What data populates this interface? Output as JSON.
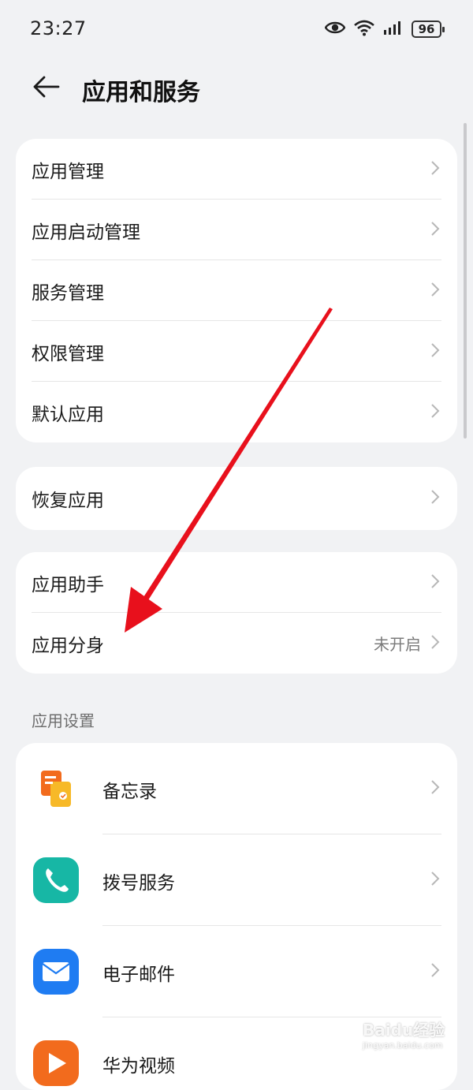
{
  "status_bar": {
    "time": "23:27",
    "battery": "96"
  },
  "header": {
    "title": "应用和服务"
  },
  "group1": [
    {
      "label": "应用管理"
    },
    {
      "label": "应用启动管理"
    },
    {
      "label": "服务管理"
    },
    {
      "label": "权限管理"
    },
    {
      "label": "默认应用"
    }
  ],
  "group2": [
    {
      "label": "恢复应用"
    }
  ],
  "group3": [
    {
      "label": "应用助手",
      "value": ""
    },
    {
      "label": "应用分身",
      "value": "未开启"
    }
  ],
  "section": {
    "title": "应用设置"
  },
  "apps": [
    {
      "label": "备忘录",
      "icon": "memo-icon"
    },
    {
      "label": "拨号服务",
      "icon": "phone-icon"
    },
    {
      "label": "电子邮件",
      "icon": "mail-icon"
    },
    {
      "label": "华为视频",
      "icon": "video-icon"
    }
  ],
  "watermark": {
    "brand": "Baidu经验",
    "url": "jingyan.baidu.com"
  },
  "colors": {
    "background": "#f1f2f4",
    "card": "#ffffff",
    "annotation_arrow": "#e8101c"
  }
}
